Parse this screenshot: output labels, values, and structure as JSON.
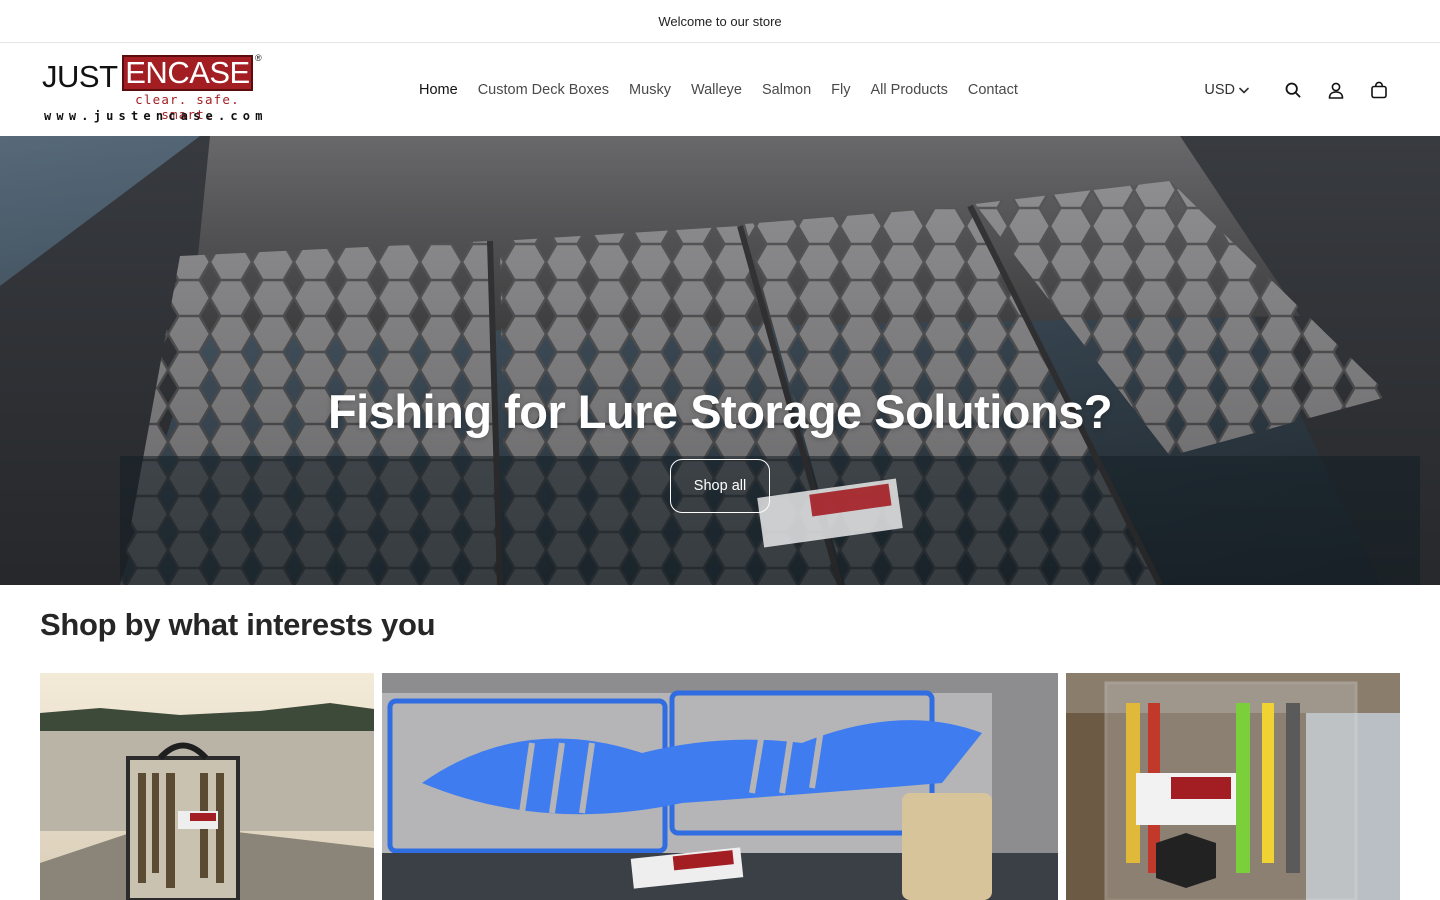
{
  "announcement": {
    "text": "Welcome to our store"
  },
  "brand": {
    "word1": "JUST",
    "word2": "ENCASE",
    "registered": "®",
    "tagline": "clear. safe. smart.",
    "url": "www.justencase.com",
    "color": "#a31e23"
  },
  "nav": {
    "items": [
      {
        "label": "Home"
      },
      {
        "label": "Custom Deck Boxes"
      },
      {
        "label": "Musky"
      },
      {
        "label": "Walleye"
      },
      {
        "label": "Salmon"
      },
      {
        "label": "Fly"
      },
      {
        "label": "All Products"
      },
      {
        "label": "Contact"
      }
    ]
  },
  "header": {
    "currency": "USD",
    "icons": [
      "search-icon",
      "account-icon",
      "cart-icon"
    ]
  },
  "hero": {
    "title": "Fishing for Lure Storage Solutions?",
    "button_label": "Shop all"
  },
  "section": {
    "title": "Shop by what interests you"
  }
}
